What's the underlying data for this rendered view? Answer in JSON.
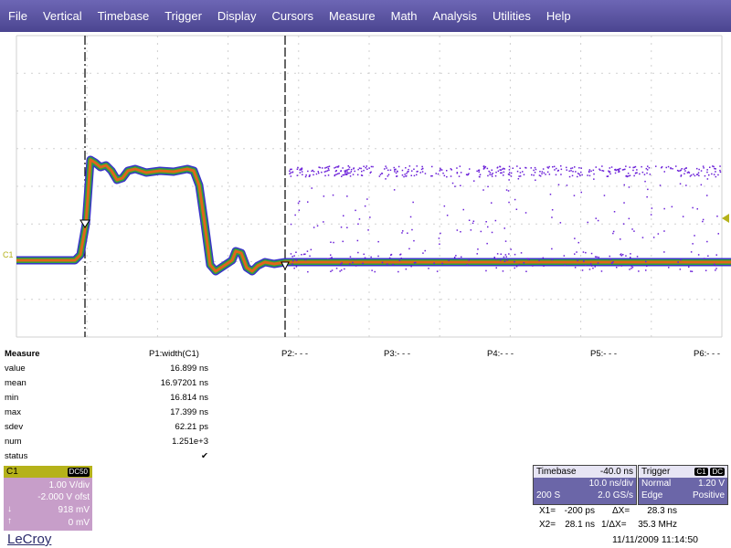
{
  "menu": [
    "File",
    "Vertical",
    "Timebase",
    "Trigger",
    "Display",
    "Cursors",
    "Measure",
    "Math",
    "Analysis",
    "Utilities",
    "Help"
  ],
  "colors": {
    "menubar": "#5a54a0",
    "grid_line": "#d0d0d0",
    "trace_outer": "#3a34c8",
    "trace_mid": "#2fa53a",
    "trace_core": "#e0651a",
    "scatter": "#6a1fd8",
    "channel_marker": "#b5b21a"
  },
  "channel_marker_label": "C1",
  "measure": {
    "title": "Measure",
    "rows": [
      "value",
      "mean",
      "min",
      "max",
      "sdev",
      "num",
      "status"
    ],
    "params": [
      {
        "label": "P1:width(C1)",
        "values": [
          "16.899 ns",
          "16.97201 ns",
          "16.814 ns",
          "17.399 ns",
          "62.21 ps",
          "1.251e+3",
          "✔"
        ]
      },
      {
        "label": "P2:- - -"
      },
      {
        "label": "P3:- - -"
      },
      {
        "label": "P4:- - -"
      },
      {
        "label": "P5:- - -"
      },
      {
        "label": "P6:- - -"
      }
    ]
  },
  "c1": {
    "label": "C1",
    "coupling": "DC50",
    "vdiv": "1.00 V/div",
    "offset": "-2.000 V ofst",
    "top_value": "918 mV",
    "bottom_value": "0 mV"
  },
  "brand": "LeCroy",
  "timebase": {
    "title": "Timebase",
    "delay": "-40.0 ns",
    "div": "10.0 ns/div",
    "samples": "200 S",
    "rate": "2.0 GS/s"
  },
  "trigger": {
    "title": "Trigger",
    "src": "C1",
    "coupling": "DC",
    "mode": "Normal",
    "level": "1.20 V",
    "type": "Edge",
    "slope": "Positive"
  },
  "cursors": {
    "x1_label": "X1=",
    "x1": "-200 ps",
    "dx_label": "ΔX=",
    "dx": "28.3 ns",
    "x2_label": "X2=",
    "x2": "28.1 ns",
    "inv_label": "1/ΔX=",
    "inv": "35.3 MHz"
  },
  "datetime": "11/11/2009 11:14:50"
}
